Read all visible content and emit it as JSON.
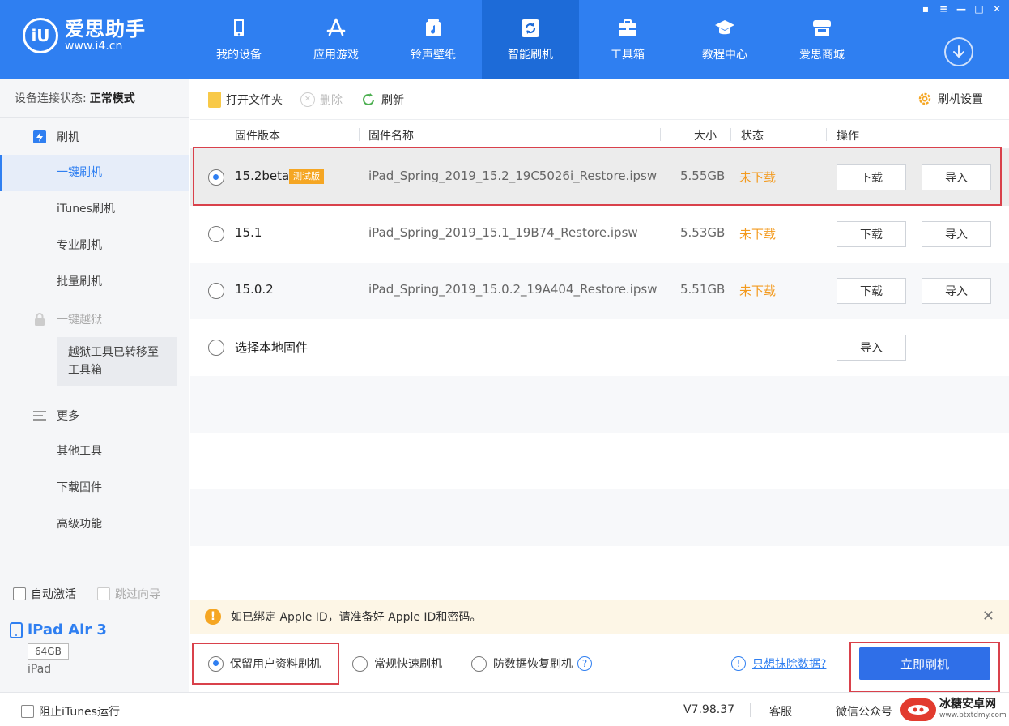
{
  "app": {
    "logo_name": "爱思助手",
    "logo_url": "www.i4.cn",
    "logo_mark": "iU"
  },
  "nav": [
    {
      "label": "我的设备",
      "icon": "phone-icon"
    },
    {
      "label": "应用游戏",
      "icon": "app-store-icon"
    },
    {
      "label": "铃声壁纸",
      "icon": "music-icon"
    },
    {
      "label": "智能刷机",
      "icon": "refresh-icon",
      "active": true
    },
    {
      "label": "工具箱",
      "icon": "toolbox-icon"
    },
    {
      "label": "教程中心",
      "icon": "graduation-cap-icon"
    },
    {
      "label": "爱思商城",
      "icon": "store-icon"
    }
  ],
  "window_controls": [
    "shirt-icon",
    "menu-icon",
    "minimize-icon",
    "maximize-icon",
    "close-icon"
  ],
  "sidebar": {
    "conn_label": "设备连接状态:",
    "conn_value": "正常模式",
    "flash_group": "刷机",
    "items": [
      "一键刷机",
      "iTunes刷机",
      "专业刷机",
      "批量刷机"
    ],
    "jailbreak_label": "一键越狱",
    "jailbreak_note": "越狱工具已转移至工具箱",
    "more_group": "更多",
    "more_items": [
      "其他工具",
      "下载固件",
      "高级功能"
    ],
    "auto_activate": "自动激活",
    "skip_guide": "跳过向导",
    "device_name": "iPad Air 3",
    "device_capacity": "64GB",
    "device_type": "iPad"
  },
  "toolbar": {
    "open_folder": "打开文件夹",
    "delete": "删除",
    "refresh": "刷新",
    "settings": "刷机设置"
  },
  "table": {
    "headers": {
      "version": "固件版本",
      "name": "固件名称",
      "size": "大小",
      "status": "状态",
      "action": "操作"
    },
    "rows": [
      {
        "version": "15.2beta",
        "tag": "测试版",
        "name": "iPad_Spring_2019_15.2_19C5026i_Restore.ipsw",
        "size": "5.55GB",
        "status": "未下载",
        "download": "下载",
        "import": "导入",
        "selected": true
      },
      {
        "version": "15.1",
        "name": "iPad_Spring_2019_15.1_19B74_Restore.ipsw",
        "size": "5.53GB",
        "status": "未下载",
        "download": "下载",
        "import": "导入"
      },
      {
        "version": "15.0.2",
        "name": "iPad_Spring_2019_15.0.2_19A404_Restore.ipsw",
        "size": "5.51GB",
        "status": "未下载",
        "download": "下载",
        "import": "导入"
      }
    ],
    "local": {
      "label": "选择本地固件",
      "import": "导入"
    }
  },
  "notice": {
    "text": "如已绑定 Apple ID，请准备好 Apple ID和密码。"
  },
  "flash_options": {
    "keep_data": "保留用户资料刷机",
    "quick": "常规快速刷机",
    "anti_recovery": "防数据恢复刷机",
    "erase_link": "只想抹除数据?",
    "flash_now": "立即刷机"
  },
  "statusbar": {
    "block_itunes": "阻止iTunes运行",
    "version": "V7.98.37",
    "service": "客服",
    "wechat": "微信公众号",
    "watermark_title": "冰糖安卓网",
    "watermark_url": "www.btxtdmy.com"
  },
  "colors": {
    "brand": "#2f7ff1",
    "status_orange": "#f39a1e",
    "highlight_red": "#d9414b"
  }
}
